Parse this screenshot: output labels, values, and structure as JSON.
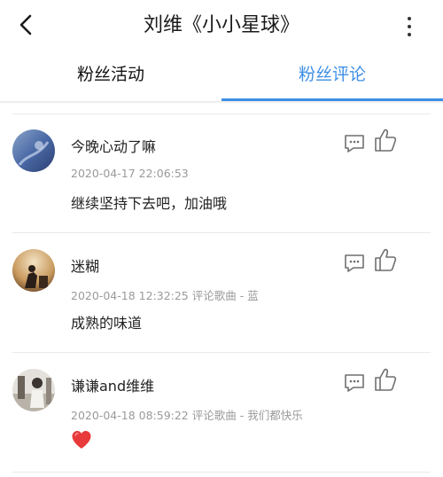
{
  "header": {
    "title": "刘维《小小星球》",
    "back_icon": "chevron-left-icon",
    "more_icon": "more-vertical-icon"
  },
  "tabs": [
    {
      "label": "粉丝活动",
      "active": false
    },
    {
      "label": "粉丝评论",
      "active": true
    }
  ],
  "colors": {
    "accent": "#3d8fe6",
    "meta_text": "#9a9a9a",
    "divider": "#e9e9e9"
  },
  "comments": [
    {
      "username": "今晚心动了嘛",
      "meta": "2020-04-17 22:06:53",
      "content": "继续坚持下去吧，加油哦",
      "avatar_icon": "avatar-blue"
    },
    {
      "username": "迷糊",
      "meta": "2020-04-18 12:32:25 评论歌曲 - 蓝",
      "content": "成熟的味道",
      "avatar_icon": "avatar-warm"
    },
    {
      "username": "谦谦and维维",
      "meta": "2020-04-18 08:59:22 评论歌曲 - 我们都快乐",
      "content": "❤️",
      "avatar_icon": "avatar-gray"
    }
  ]
}
